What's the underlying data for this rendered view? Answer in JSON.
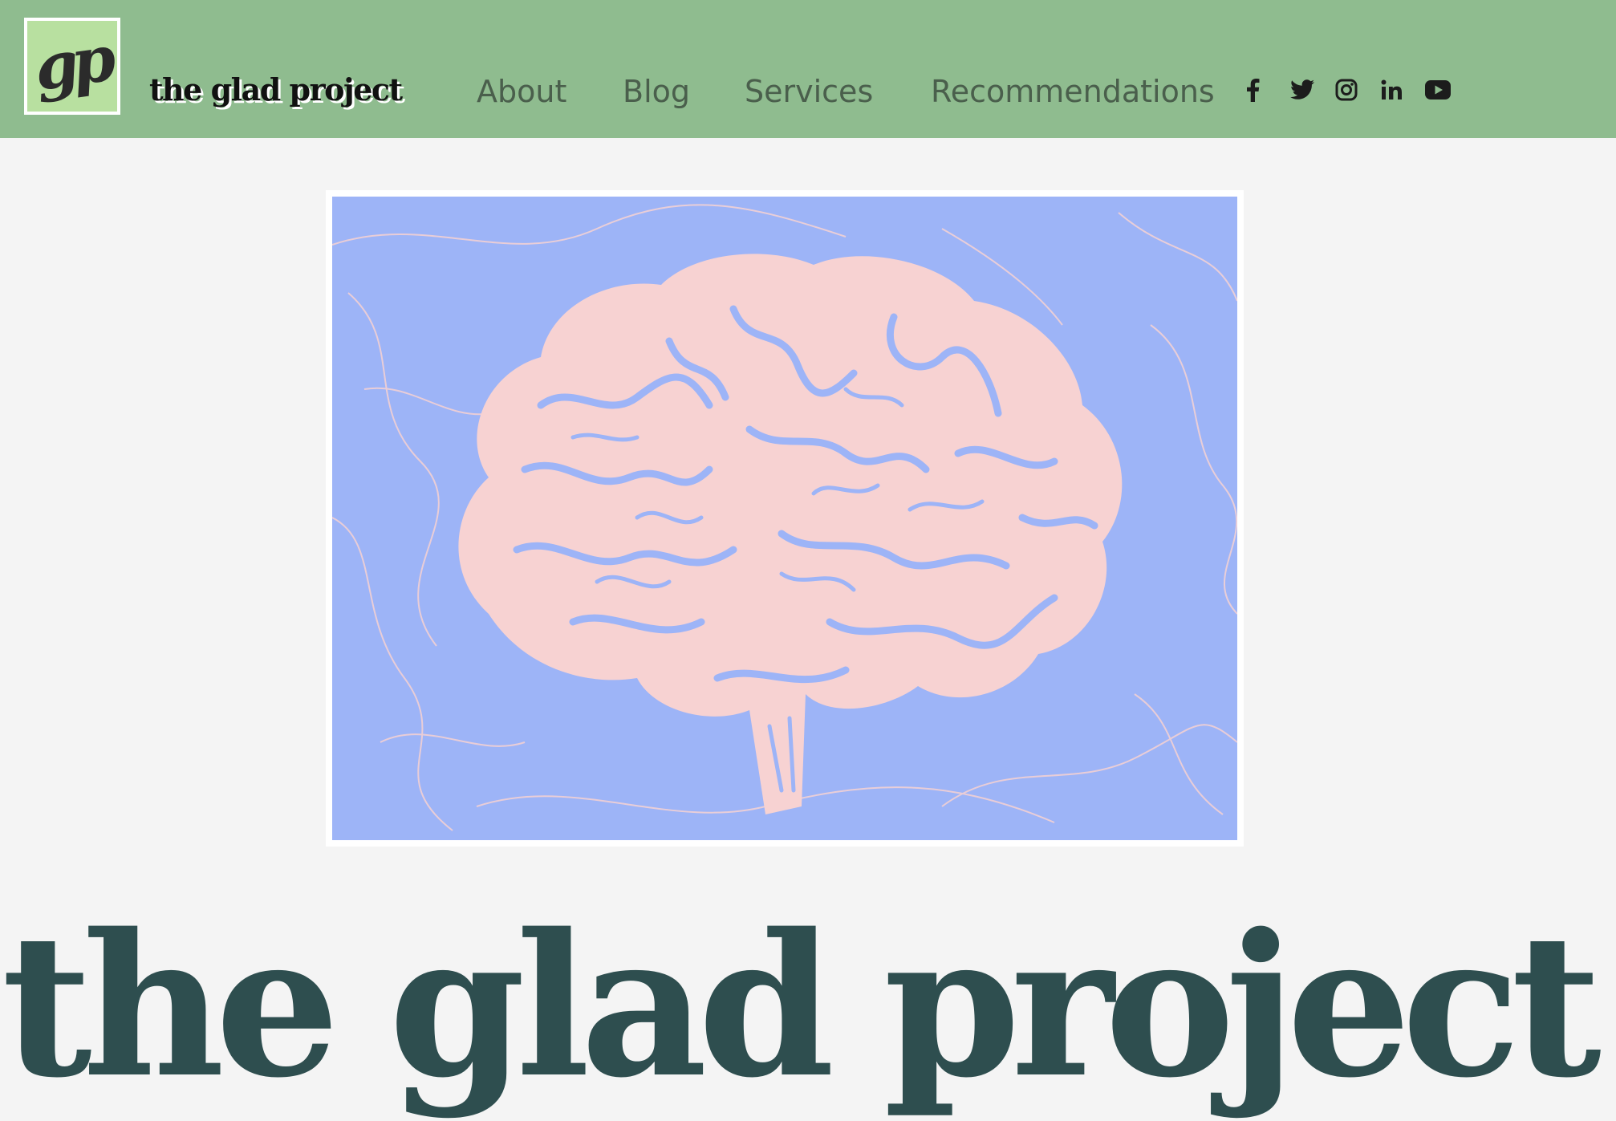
{
  "header": {
    "logo_text": "gp",
    "brand": "the glad project",
    "colors": {
      "background": "#8fbc8f",
      "logo_bg": "#b8e0a0",
      "nav_text": "#4a5f4c"
    }
  },
  "nav": {
    "items": [
      {
        "label": "About"
      },
      {
        "label": "Blog"
      },
      {
        "label": "Services"
      },
      {
        "label": "Recommendations"
      }
    ]
  },
  "social": [
    {
      "icon": "facebook-icon"
    },
    {
      "icon": "twitter-icon"
    },
    {
      "icon": "instagram-icon"
    },
    {
      "icon": "linkedin-icon"
    },
    {
      "icon": "youtube-icon"
    }
  ],
  "hero": {
    "image": "brain-illustration",
    "colors": {
      "background": "#9db4f7",
      "brain": "#f7d2d2"
    }
  },
  "main": {
    "title": "the glad project",
    "title_color": "#2e4e4f"
  }
}
